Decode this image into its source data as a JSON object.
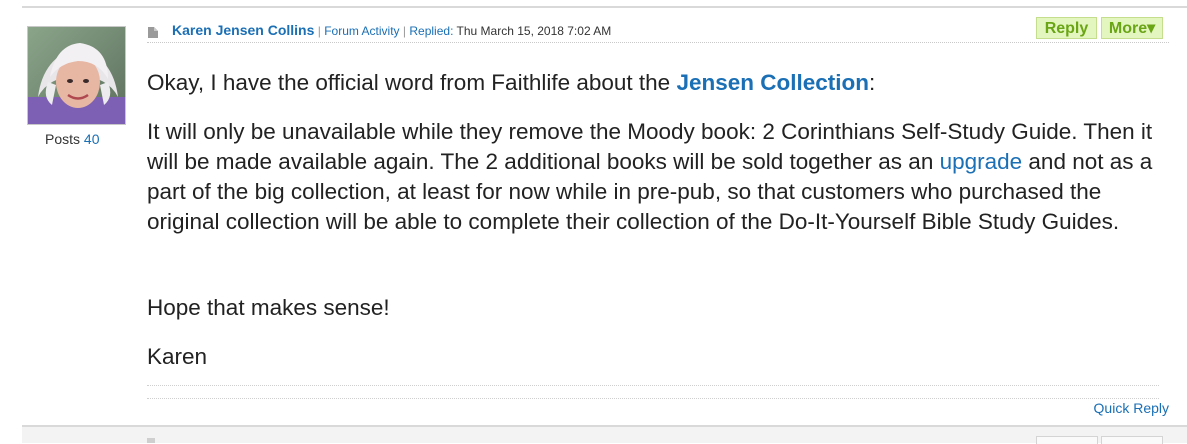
{
  "post": {
    "author": "Karen Jensen Collins",
    "forum_activity": "Forum Activity",
    "replied_label": "Replied:",
    "replied_date": "Thu March 15, 2018 7:02 AM",
    "reply_label": "Reply",
    "more_label": "More▾",
    "posts_label": "Posts",
    "posts_count": "40",
    "body": {
      "p1_text": "Okay, I have the official word from Faithlife about the ",
      "p1_link": "Jensen Collection",
      "p1_end": ":",
      "p2_before": "It will only be unavailable while they remove the Moody book: 2 Corinthians Self-Study Guide. Then it will be made available again. The 2 additional books will be sold together as an ",
      "p2_link": "upgrade",
      "p2_after": " and not as a part of the big collection, at least for now while in pre-pub, so that customers who purchased the original collection will be able to complete their collection of the Do-It-Yourself Bible Study Guides.",
      "p3": "Hope that makes sense!",
      "p4": "Karen"
    },
    "quick_reply": "Quick Reply"
  },
  "colors": {
    "link": "#1a6fb5",
    "button_bg": "#e4f6bf",
    "button_text": "#6aa516"
  },
  "icons": {
    "post": "post-document-icon"
  }
}
